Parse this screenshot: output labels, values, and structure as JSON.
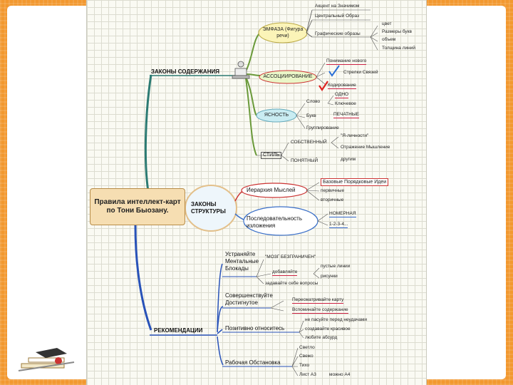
{
  "center": {
    "title": "Правила интеллект-карт по Тони Быозану."
  },
  "branches": {
    "content": {
      "label": "ЗАКОНЫ СОДЕРЖАНИЯ"
    },
    "structure": {
      "label": "ЗАКОНЫ СТРУКТУРЫ"
    },
    "recommend": {
      "label": "РЕКОМЕНДАЦИИ"
    }
  },
  "content": {
    "emphasis": {
      "label": "ЭМФАЗА (Фигура речи)",
      "items": [
        "Акцент на Значимом",
        "Центральный Образ",
        "Графические образы"
      ],
      "graphics": [
        "цвет",
        "Размеры букв",
        "объем",
        "Толщина линий"
      ]
    },
    "association": {
      "label": "АССОЦИИРОВАНИЕ",
      "items": [
        "Понимание нового",
        "Стрелки Связей",
        "Кодирование"
      ]
    },
    "clarity": {
      "label": "ЯСНОСТЬ",
      "items": [
        "Слово",
        "Букв",
        "Группирование"
      ],
      "word": [
        "ОДНО",
        "Ключевое"
      ],
      "letters": [
        "ПЕЧАТНЫЕ"
      ]
    },
    "style": {
      "label": "СТИЛЬ",
      "items": [
        "СОБСТВЕННЫЙ",
        "ПОНЯТНЫЙ"
      ],
      "own": [
        "\"Я-личности\"",
        "Отражение Мышление"
      ],
      "clear": [
        "другим"
      ]
    }
  },
  "structure": {
    "hierarchy": {
      "label": "Иерархия Мыслей",
      "items": [
        "Базовые Порядковые Идеи",
        "первичные",
        "вторичные"
      ]
    },
    "sequence": {
      "label": "Последовательность изложения",
      "items": [
        "НОМЕРНАЯ",
        "1-2-3-4..."
      ]
    }
  },
  "recommend": {
    "blocks": {
      "label": "Устраняйте Ментальные Блокады",
      "items": [
        "\"МОЗГ БЕЗГРАНИЧЕН\"",
        "добавляйте",
        "задавайте себе вопросы"
      ],
      "add": [
        "пустые линии",
        "рисунки"
      ]
    },
    "improve": {
      "label": "Совершенствуйте Достигнутое",
      "items": [
        "Пересматривайте карту",
        "Вспоминайте содержание"
      ]
    },
    "positive": {
      "label": "Позитивно относитесь",
      "items": [
        "не пасуйте перед неудачами",
        "создавайте красивое",
        "любите абсурд"
      ]
    },
    "workplace": {
      "label": "Рабочая Обстановка",
      "items": [
        "Светло",
        "Свежо",
        "Тихо",
        "Лист А3"
      ],
      "a3": [
        "можно А4"
      ]
    }
  }
}
